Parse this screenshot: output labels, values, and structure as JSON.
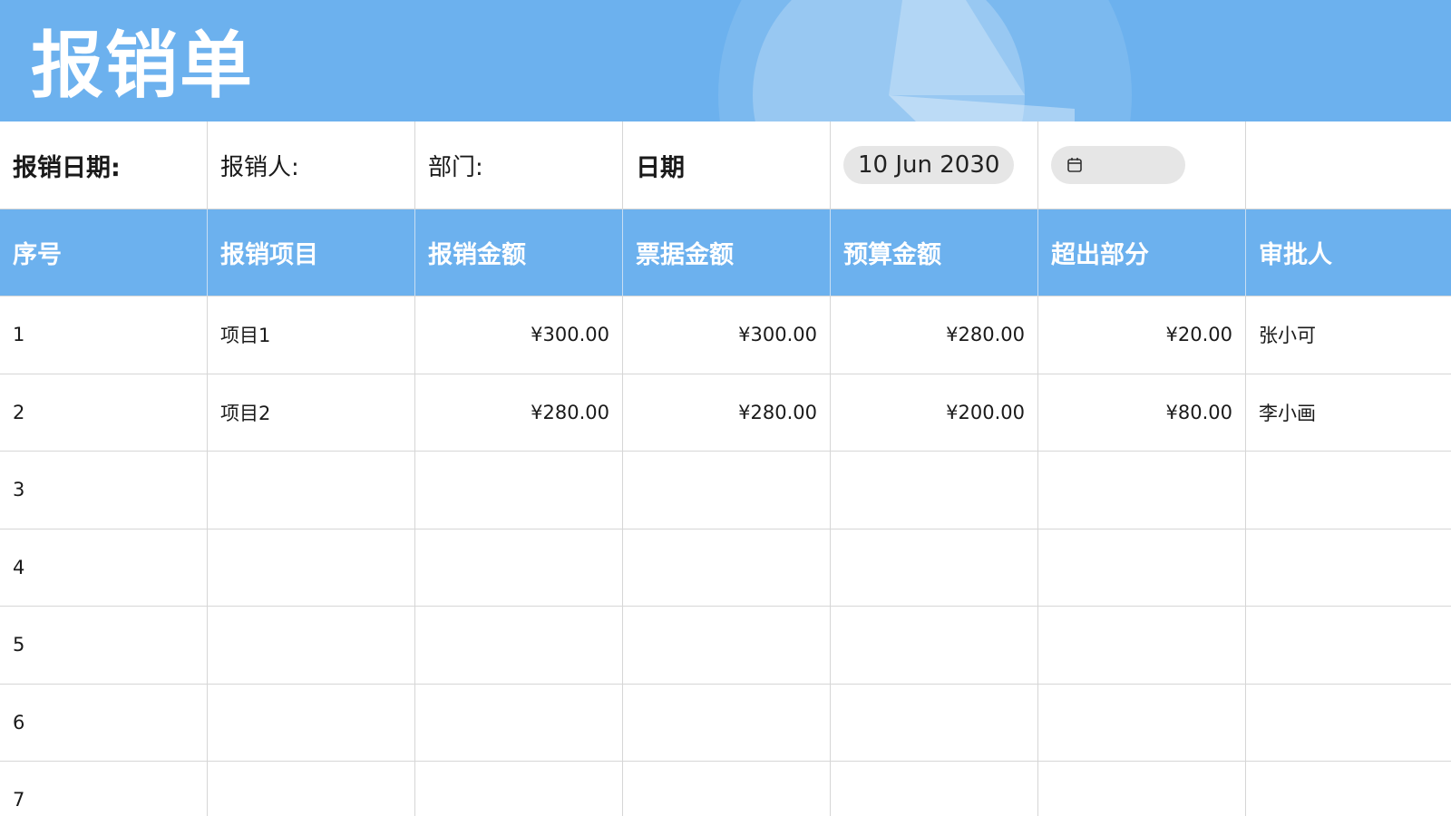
{
  "page": {
    "title": "报销单"
  },
  "info": {
    "date_label": "报销日期:",
    "person_label": "报销人:",
    "dept_label": "部门:",
    "date2_label": "日期",
    "date_value": "10 Jun 2030",
    "empty_date_icon": "calendar-icon"
  },
  "table": {
    "headers": [
      "序号",
      "报销项目",
      "报销金额",
      "票据金额",
      "预算金额",
      "超出部分",
      "审批人"
    ],
    "rows": [
      [
        "1",
        "项目1",
        "¥300.00",
        "¥300.00",
        "¥280.00",
        "¥20.00",
        "张小可"
      ],
      [
        "2",
        "项目2",
        "¥280.00",
        "¥280.00",
        "¥200.00",
        "¥80.00",
        "李小画"
      ],
      [
        "3",
        "",
        "",
        "",
        "",
        "",
        ""
      ],
      [
        "4",
        "",
        "",
        "",
        "",
        "",
        ""
      ],
      [
        "5",
        "",
        "",
        "",
        "",
        "",
        ""
      ],
      [
        "6",
        "",
        "",
        "",
        "",
        "",
        ""
      ],
      [
        "7",
        "",
        "",
        "",
        "",
        "",
        ""
      ]
    ]
  },
  "colors": {
    "accent": "#6cb1ee",
    "grid": "#d6d6d6",
    "pill": "#e6e6e6"
  }
}
